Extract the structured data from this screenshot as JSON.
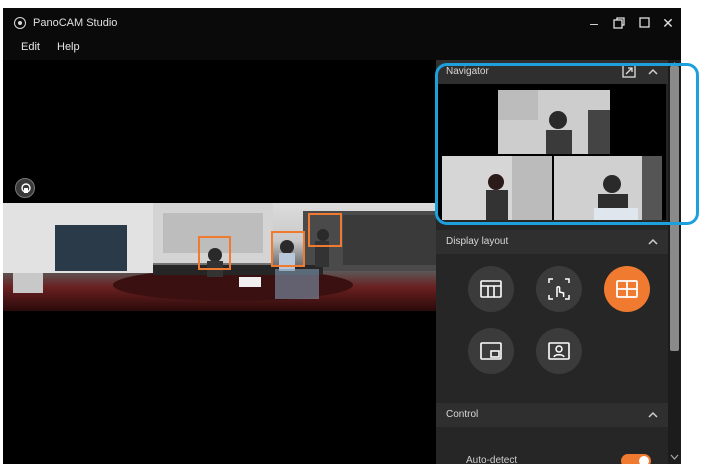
{
  "window": {
    "title": "PanoCAM Studio",
    "minimize_icon": "minimize-icon",
    "restore_icon": "restore-icon",
    "maximize_icon": "maximize-icon",
    "close_icon": "close-icon"
  },
  "menu": {
    "items": [
      {
        "label": "Edit"
      },
      {
        "label": "Help"
      }
    ]
  },
  "navigator": {
    "title": "Navigator"
  },
  "display_layout": {
    "title": "Display layout",
    "buttons": [
      {
        "icon": "three-column-layout-icon",
        "active": false
      },
      {
        "icon": "manual-select-layout-icon",
        "active": false
      },
      {
        "icon": "grid-layout-icon",
        "active": true
      },
      {
        "icon": "picture-in-picture-icon",
        "active": false
      },
      {
        "icon": "speaker-layout-icon",
        "active": false
      }
    ]
  },
  "control": {
    "title": "Control",
    "auto_detect_label": "Auto-detect",
    "auto_detect_on": true
  },
  "colors": {
    "accent": "#f07a30",
    "highlight": "#1ea0dc",
    "panel_bg": "#262626"
  }
}
